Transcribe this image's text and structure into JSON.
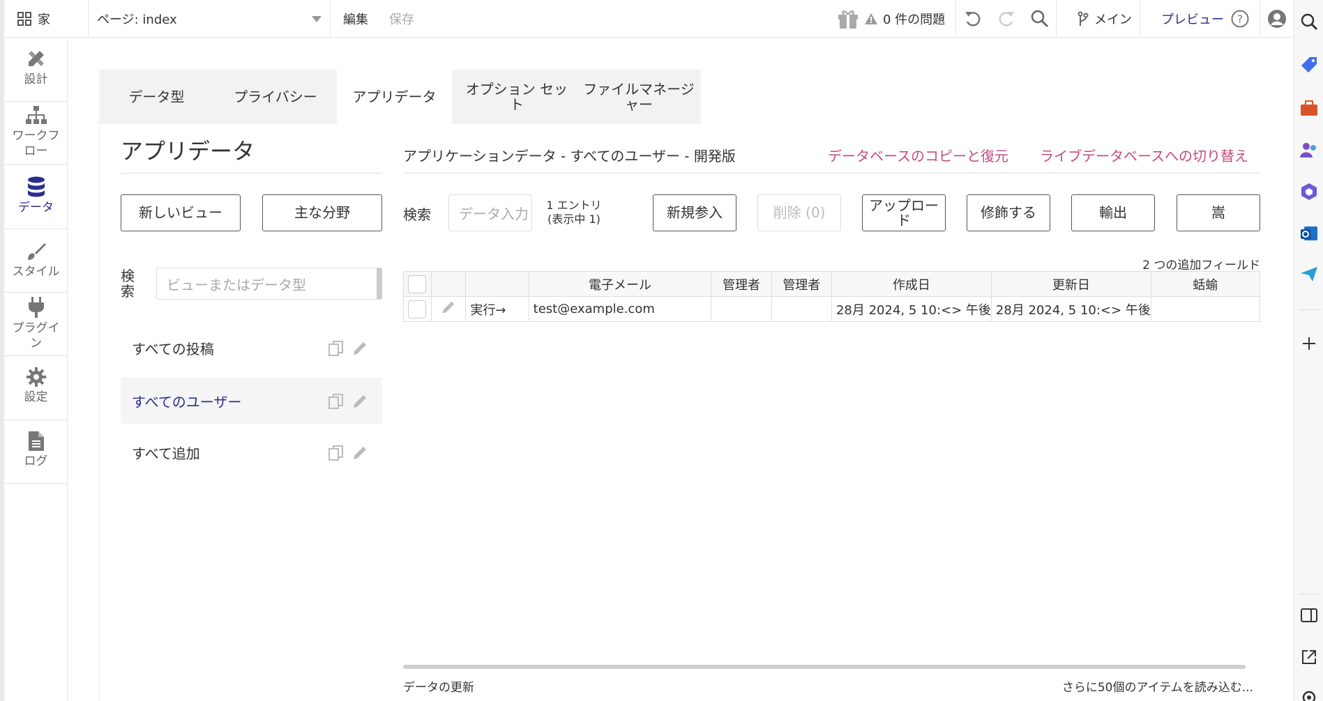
{
  "topbar": {
    "home_label": "家",
    "page_label": "ページ: index",
    "edit_label": "編集",
    "save_label": "保存",
    "issues_label": "0 件の問題",
    "branch_label": "メイン",
    "preview_label": "プレビュー"
  },
  "nav": {
    "items": [
      {
        "label": "設計",
        "icon": "design-icon"
      },
      {
        "label": "ワークフロー",
        "icon": "workflow-icon"
      },
      {
        "label": "データ",
        "icon": "database-icon"
      },
      {
        "label": "スタイル",
        "icon": "brush-icon"
      },
      {
        "label": "プラグイン",
        "icon": "plug-icon"
      },
      {
        "label": "設定",
        "icon": "gear-icon"
      },
      {
        "label": "ログ",
        "icon": "document-icon"
      }
    ]
  },
  "tabs": [
    {
      "label": "データ型"
    },
    {
      "label": "プライバシー"
    },
    {
      "label": "アプリデータ"
    },
    {
      "label": "オプション セット"
    },
    {
      "label": "ファイルマネージャー"
    }
  ],
  "left": {
    "title": "アプリデータ",
    "new_view_button": "新しいビュー",
    "primary_fields_button": "主な分野",
    "search_label": "検索",
    "search_placeholder": "ビューまたはデータ型",
    "views": [
      {
        "label": "すべての投稿"
      },
      {
        "label": "すべてのユーザー"
      },
      {
        "label": "すべて追加"
      }
    ]
  },
  "right": {
    "header_title": "アプリケーションデータ - すべてのユーザー - 開発版",
    "copy_restore_link": "データベースのコピーと復元",
    "switch_live_link": "ライブデータベースへの切り替え",
    "search_label": "検索",
    "search_placeholder": "データ入力",
    "entries_line1": "1 エントリ",
    "entries_line2": "(表示中 1)",
    "new_entry_button": "新規参入",
    "delete_button": "削除 (0)",
    "upload_button": "アップロード",
    "modify_button": "修飾する",
    "export_button": "輸出",
    "extra_button": "嵩",
    "additional_fields": "2 つの追加フィールド",
    "columns": [
      "電子メール",
      "管理者",
      "管理者",
      "作成日",
      "更新日",
      "蛞蝓"
    ],
    "rows": [
      {
        "run": "実行→",
        "email": "test@example.com",
        "admin1": "",
        "admin2": "",
        "created": "28月 2024, 5 10:<> 午後",
        "updated": "28月 2024, 5 10:<> 午後",
        "slug": ""
      }
    ],
    "footer_refresh": "データの更新",
    "footer_load_more": "さらに50個のアイテムを読み込む..."
  },
  "colors": {
    "accent_navy": "#2a2e8c",
    "link_pink": "#c44b82"
  }
}
